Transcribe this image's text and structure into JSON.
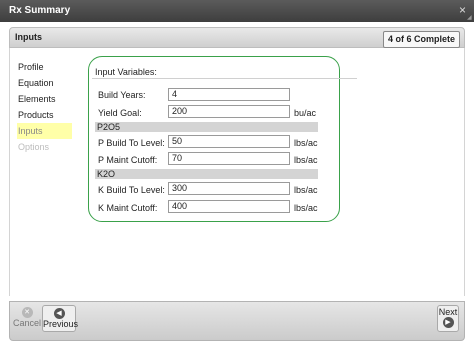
{
  "window": {
    "title": "Rx Summary",
    "close_glyph": "×"
  },
  "step": {
    "title": "Inputs",
    "progress": "4 of 6 Complete"
  },
  "sidebar": {
    "items": [
      {
        "label": "Profile",
        "state": "normal"
      },
      {
        "label": "Equation",
        "state": "normal"
      },
      {
        "label": "Elements",
        "state": "normal"
      },
      {
        "label": "Products",
        "state": "normal"
      },
      {
        "label": "Inputs",
        "state": "active"
      },
      {
        "label": "Options",
        "state": "disabled"
      }
    ]
  },
  "panel": {
    "title": "Input Variables:",
    "build_years": {
      "label": "Build Years:",
      "value": "4"
    },
    "yield_goal": {
      "label": "Yield Goal:",
      "value": "200",
      "unit": "bu/ac"
    },
    "p2o5": {
      "header": "P2O5",
      "build_to_level": {
        "label": "P Build To Level:",
        "value": "50",
        "unit": "lbs/ac"
      },
      "maint_cutoff": {
        "label": "P Maint Cutoff:",
        "value": "70",
        "unit": "lbs/ac"
      }
    },
    "k2o": {
      "header": "K2O",
      "build_to_level": {
        "label": "K Build To Level:",
        "value": "300",
        "unit": "lbs/ac"
      },
      "maint_cutoff": {
        "label": "K Maint Cutoff:",
        "value": "400",
        "unit": "lbs/ac"
      }
    }
  },
  "footer": {
    "cancel_label": "Cancel",
    "cancel_icon": "x-circle-icon",
    "previous_label": "Previous",
    "previous_icon": "arrow-left-circle-icon",
    "next_label": "Next",
    "next_icon": "arrow-right-circle-icon",
    "icon_glyphs": {
      "cancel": "✕",
      "previous": "◀",
      "next": "▶"
    }
  },
  "colors": {
    "panel_border": "#3aa14a",
    "active_highlight": "#ffffa8",
    "titlebar": "#4a4a4a"
  }
}
